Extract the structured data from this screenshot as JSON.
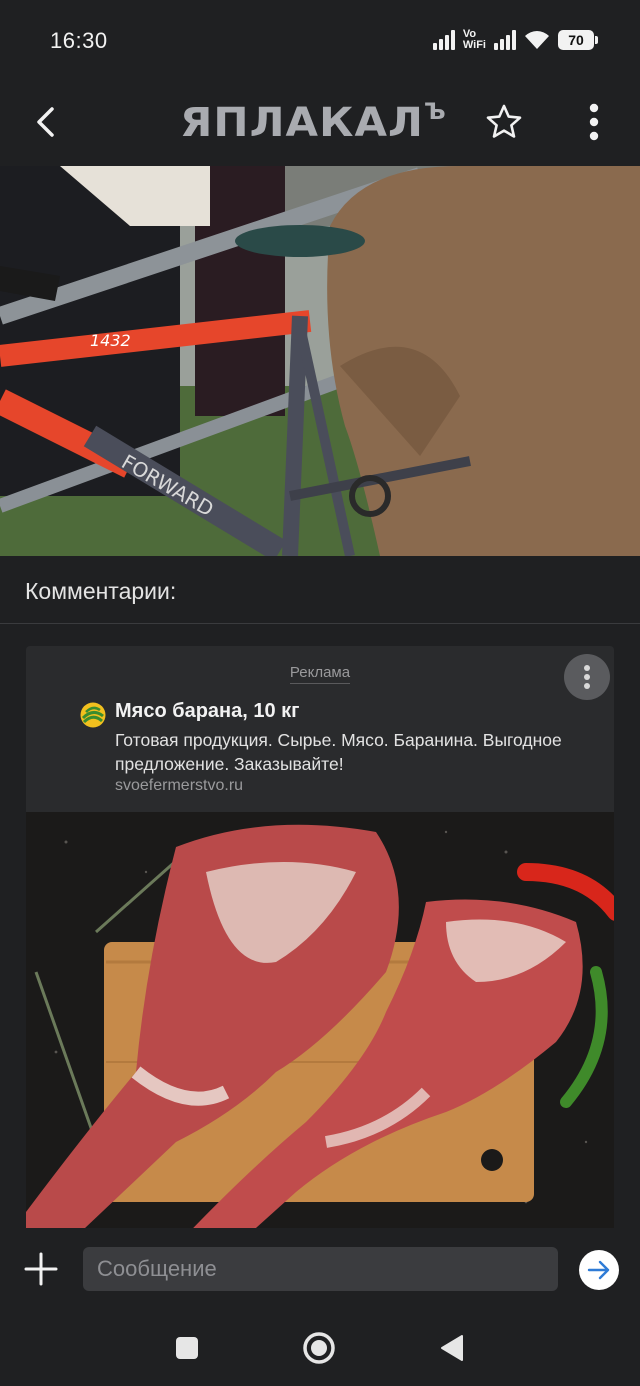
{
  "status_bar": {
    "time": "16:30",
    "network_label_top": "Vo",
    "network_label_bottom": "WiFi",
    "battery": "70",
    "icons": [
      "signal-icon",
      "vowifi-icon",
      "signal-icon",
      "wifi-icon",
      "battery-icon"
    ]
  },
  "app_bar": {
    "logo_text": "ЯПЛАКАЛ",
    "logo_suffix": "Ъ",
    "icons": [
      "back-arrow-icon",
      "star-icon",
      "more-vertical-icon"
    ]
  },
  "comments": {
    "title": "Комментарии:"
  },
  "ad": {
    "label": "Реклама",
    "title": "Мясо барана, 10 кг",
    "text": "Готовая продукция. Сырье. Мясо. Баранина. Выгодное предложение. Заказывайте!",
    "domain": "svoefermerstvo.ru"
  },
  "composer": {
    "placeholder": "Сообщение",
    "icons": [
      "plus-icon",
      "send-arrow-icon"
    ]
  },
  "nav": {
    "icons": [
      "recents-square-icon",
      "home-circle-icon",
      "back-triangle-icon"
    ]
  },
  "colors": {
    "background": "#1f2022",
    "card": "#2a2b2d",
    "input": "#3b3c3f",
    "send_arrow": "#2e7bd6",
    "logo": "#a9abb0"
  }
}
